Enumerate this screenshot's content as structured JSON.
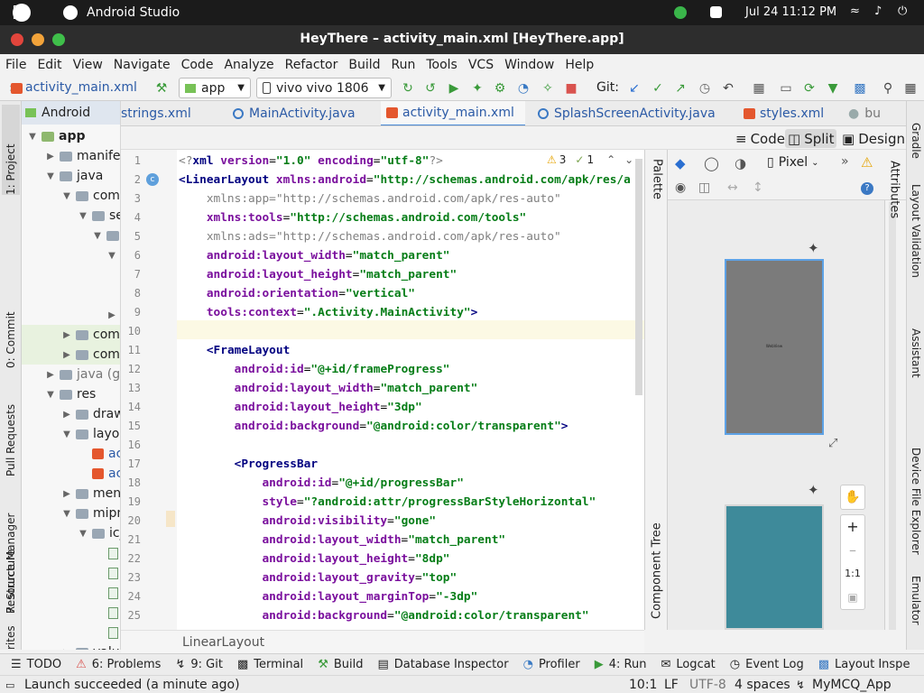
{
  "system": {
    "app_name": "Android Studio",
    "datetime": "Jul 24  11:12 PM"
  },
  "window": {
    "title": "HeyThere – activity_main.xml [HeyThere.app]"
  },
  "menu": [
    "File",
    "Edit",
    "View",
    "Navigate",
    "Code",
    "Analyze",
    "Refactor",
    "Build",
    "Run",
    "Tools",
    "VCS",
    "Window",
    "Help"
  ],
  "toolbar": {
    "file_breadcrumb": "activity_main.xml",
    "run_config": "app",
    "device": "vivo vivo 1806",
    "git_label": "Git:"
  },
  "left_tools": {
    "project": "1: Project",
    "commit": "0: Commit",
    "pull_requests": "Pull Requests",
    "resource_manager": "Resource Manager",
    "structure": "7: Structure",
    "favorites": "rites"
  },
  "right_tools": {
    "gradle": "Gradle",
    "layout_validation": "Layout Validation",
    "assistant": "Assistant",
    "device_file_explorer": "Device File Explorer",
    "emulator": "Emulator"
  },
  "project": {
    "view_mode": "Android",
    "tree": [
      {
        "label": "app",
        "bold": true
      },
      {
        "label": "manifests"
      },
      {
        "label": "java"
      },
      {
        "label": "com"
      },
      {
        "label": "se"
      },
      {
        "label": ""
      },
      {
        "label": ""
      },
      {
        "label": ""
      },
      {
        "label": ""
      },
      {
        "label": "com"
      },
      {
        "label": "com"
      },
      {
        "label": "java (ge"
      },
      {
        "label": "res"
      },
      {
        "label": "draw"
      },
      {
        "label": "layou"
      },
      {
        "label": "ac"
      },
      {
        "label": "ac"
      },
      {
        "label": "menu"
      },
      {
        "label": "mipm"
      },
      {
        "label": "ic_"
      },
      {
        "label": ""
      },
      {
        "label": ""
      },
      {
        "label": ""
      },
      {
        "label": ""
      },
      {
        "label": ""
      },
      {
        "label": "valu"
      }
    ]
  },
  "tabs": [
    "strings.xml",
    "MainActivity.java",
    "activity_main.xml",
    "SplashScreenActivity.java",
    "styles.xml",
    "bu"
  ],
  "view_modes": {
    "code": "Code",
    "split": "Split",
    "design": "Design"
  },
  "inspection": {
    "warnings": "3",
    "weak_warnings": "1"
  },
  "code_lines": [
    {
      "n": "1",
      "parts": [
        [
          "gr",
          "<?"
        ],
        [
          "tg",
          "xml "
        ],
        [
          "at",
          "version"
        ],
        [
          "pl",
          "="
        ],
        [
          "st",
          "\"1.0\""
        ],
        [
          "pl",
          " "
        ],
        [
          "at",
          "encoding"
        ],
        [
          "pl",
          "="
        ],
        [
          "st",
          "\"utf-8\""
        ],
        [
          "gr",
          "?>"
        ]
      ]
    },
    {
      "n": "2",
      "parts": [
        [
          "tg",
          "<LinearLayout "
        ],
        [
          "ns",
          "xmlns:android"
        ],
        [
          "pl",
          "="
        ],
        [
          "st",
          "\"http://schemas.android.com/apk/res/a"
        ]
      ]
    },
    {
      "n": "3",
      "parts": [
        [
          "gr",
          "    xmlns:app=\"http://schemas.android.com/apk/res-auto\""
        ]
      ]
    },
    {
      "n": "4",
      "parts": [
        [
          "pl",
          "    "
        ],
        [
          "ns",
          "xmlns:tools"
        ],
        [
          "pl",
          "="
        ],
        [
          "st",
          "\"http://schemas.android.com/tools\""
        ]
      ]
    },
    {
      "n": "5",
      "parts": [
        [
          "gr",
          "    xmlns:ads=\"http://schemas.android.com/apk/res-auto\""
        ]
      ]
    },
    {
      "n": "6",
      "parts": [
        [
          "pl",
          "    "
        ],
        [
          "at",
          "android:layout_width"
        ],
        [
          "pl",
          "="
        ],
        [
          "st",
          "\"match_parent\""
        ]
      ]
    },
    {
      "n": "7",
      "parts": [
        [
          "pl",
          "    "
        ],
        [
          "at",
          "android:layout_height"
        ],
        [
          "pl",
          "="
        ],
        [
          "st",
          "\"match_parent\""
        ]
      ]
    },
    {
      "n": "8",
      "parts": [
        [
          "pl",
          "    "
        ],
        [
          "at",
          "android:orientation"
        ],
        [
          "pl",
          "="
        ],
        [
          "st",
          "\"vertical\""
        ]
      ]
    },
    {
      "n": "9",
      "parts": [
        [
          "pl",
          "    "
        ],
        [
          "at",
          "tools:context"
        ],
        [
          "pl",
          "="
        ],
        [
          "st",
          "\".Activity.MainActivity\""
        ],
        [
          "tg",
          ">"
        ]
      ]
    },
    {
      "n": "10",
      "parts": []
    },
    {
      "n": "11",
      "parts": [
        [
          "pl",
          "    "
        ],
        [
          "tg",
          "<FrameLayout"
        ]
      ]
    },
    {
      "n": "12",
      "parts": [
        [
          "pl",
          "        "
        ],
        [
          "at",
          "android:id"
        ],
        [
          "pl",
          "="
        ],
        [
          "st",
          "\"@+id/frameProgress\""
        ]
      ]
    },
    {
      "n": "13",
      "parts": [
        [
          "pl",
          "        "
        ],
        [
          "at",
          "android:layout_width"
        ],
        [
          "pl",
          "="
        ],
        [
          "st",
          "\"match_parent\""
        ]
      ]
    },
    {
      "n": "14",
      "parts": [
        [
          "pl",
          "        "
        ],
        [
          "at",
          "android:layout_height"
        ],
        [
          "pl",
          "="
        ],
        [
          "st",
          "\"3dp\""
        ]
      ]
    },
    {
      "n": "15",
      "parts": [
        [
          "pl",
          "        "
        ],
        [
          "at",
          "android:background"
        ],
        [
          "pl",
          "="
        ],
        [
          "st",
          "\"@android:color/transparent\""
        ],
        [
          "tg",
          ">"
        ]
      ]
    },
    {
      "n": "16",
      "parts": []
    },
    {
      "n": "17",
      "parts": [
        [
          "pl",
          "        "
        ],
        [
          "tg",
          "<ProgressBar"
        ]
      ]
    },
    {
      "n": "18",
      "parts": [
        [
          "pl",
          "            "
        ],
        [
          "at",
          "android:id"
        ],
        [
          "pl",
          "="
        ],
        [
          "st",
          "\"@+id/progressBar\""
        ]
      ]
    },
    {
      "n": "19",
      "parts": [
        [
          "pl",
          "            "
        ],
        [
          "at",
          "style"
        ],
        [
          "pl",
          "="
        ],
        [
          "st",
          "\"?android:attr/progressBarStyleHorizontal\""
        ]
      ]
    },
    {
      "n": "20",
      "parts": [
        [
          "pl",
          "            "
        ],
        [
          "at",
          "android:visibility"
        ],
        [
          "pl",
          "="
        ],
        [
          "st",
          "\"gone\""
        ]
      ]
    },
    {
      "n": "21",
      "parts": [
        [
          "pl",
          "            "
        ],
        [
          "at",
          "android:layout_width"
        ],
        [
          "pl",
          "="
        ],
        [
          "st",
          "\"match_parent\""
        ]
      ]
    },
    {
      "n": "22",
      "parts": [
        [
          "pl",
          "            "
        ],
        [
          "at",
          "android:layout_height"
        ],
        [
          "pl",
          "="
        ],
        [
          "st",
          "\"8dp\""
        ]
      ]
    },
    {
      "n": "23",
      "parts": [
        [
          "pl",
          "            "
        ],
        [
          "at",
          "android:layout_gravity"
        ],
        [
          "pl",
          "="
        ],
        [
          "st",
          "\"top\""
        ]
      ]
    },
    {
      "n": "24",
      "parts": [
        [
          "pl",
          "            "
        ],
        [
          "at",
          "android:layout_marginTop"
        ],
        [
          "pl",
          "="
        ],
        [
          "st",
          "\"-3dp\""
        ]
      ]
    },
    {
      "n": "25",
      "parts": [
        [
          "pl",
          "            "
        ],
        [
          "at",
          "android:background"
        ],
        [
          "pl",
          "="
        ],
        [
          "st",
          "\"@android:color/transparent\""
        ]
      ]
    }
  ],
  "breadcrumb": "LinearLayout",
  "design_panel": {
    "palette_label": "Palette",
    "component_tree_label": "Component Tree",
    "attributes_label": "Attributes",
    "device": "Pixel",
    "zoom_reset": "1:1",
    "blueprint_text": "WebView"
  },
  "bottom_tools": [
    {
      "icon": "todo-icon",
      "label": "TODO"
    },
    {
      "icon": "problems-icon",
      "label": "6: Problems"
    },
    {
      "icon": "git-icon",
      "label": "9: Git"
    },
    {
      "icon": "terminal-icon",
      "label": "Terminal"
    },
    {
      "icon": "build-icon",
      "label": "Build"
    },
    {
      "icon": "database-icon",
      "label": "Database Inspector"
    },
    {
      "icon": "profiler-icon",
      "label": "Profiler"
    },
    {
      "icon": "run-icon",
      "label": "4: Run"
    },
    {
      "icon": "logcat-icon",
      "label": "Logcat"
    },
    {
      "icon": "event-log-icon",
      "label": "Event Log"
    },
    {
      "icon": "layout-inspector-icon",
      "label": "Layout Inspe"
    }
  ],
  "status": {
    "message": "Launch succeeded (a minute ago)",
    "position": "10:1",
    "line_ending": "LF",
    "encoding": "UTF-8",
    "indent": "4 spaces",
    "branch": "MyMCQ_App"
  },
  "colors": {
    "accent": "#4a8ad6",
    "editor_bg": "#ffffff",
    "tag": "#000080",
    "attr": "#7a0f9d",
    "string": "#067d17"
  }
}
